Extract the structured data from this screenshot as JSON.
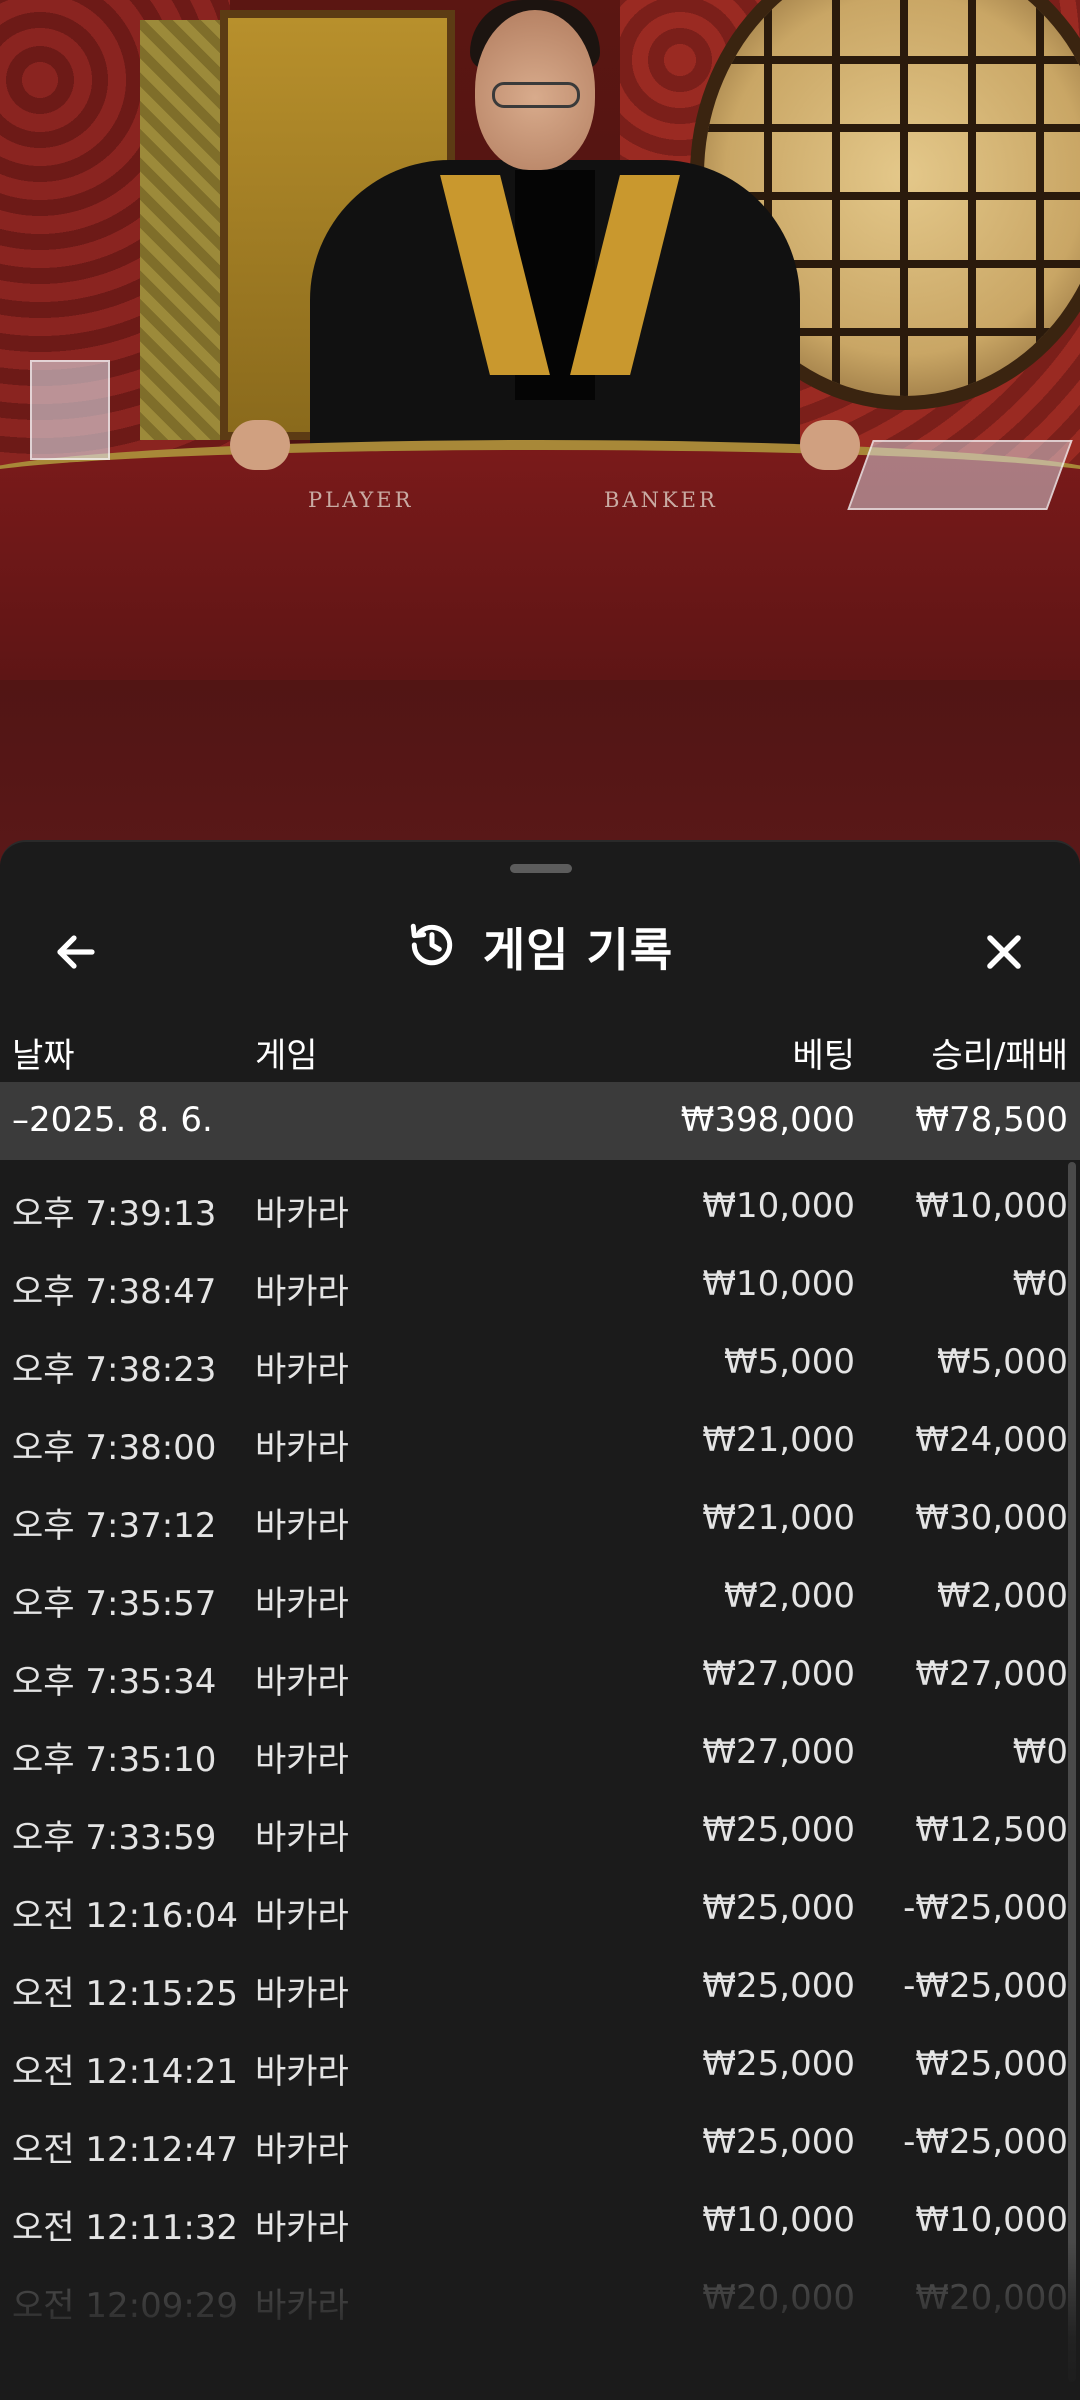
{
  "video": {
    "table_labels": {
      "player": "PLAYER",
      "banker": "BANKER"
    }
  },
  "sheet": {
    "title": "게임 기록",
    "icons": {
      "back": "arrow-left-icon",
      "history": "history-icon",
      "close": "close-icon"
    },
    "columns": {
      "date": "날짜",
      "game": "게임",
      "bet": "베팅",
      "winloss": "승리/패배"
    },
    "summary": {
      "date": "–2025. 8. 6.",
      "bet": "₩398,000",
      "winloss": "₩78,500"
    },
    "rows": [
      {
        "time": "오후 7:39:13",
        "game": "바카라",
        "bet": "₩10,000",
        "winloss": "₩10,000"
      },
      {
        "time": "오후 7:38:47",
        "game": "바카라",
        "bet": "₩10,000",
        "winloss": "₩0"
      },
      {
        "time": "오후 7:38:23",
        "game": "바카라",
        "bet": "₩5,000",
        "winloss": "₩5,000"
      },
      {
        "time": "오후 7:38:00",
        "game": "바카라",
        "bet": "₩21,000",
        "winloss": "₩24,000"
      },
      {
        "time": "오후 7:37:12",
        "game": "바카라",
        "bet": "₩21,000",
        "winloss": "₩30,000"
      },
      {
        "time": "오후 7:35:57",
        "game": "바카라",
        "bet": "₩2,000",
        "winloss": "₩2,000"
      },
      {
        "time": "오후 7:35:34",
        "game": "바카라",
        "bet": "₩27,000",
        "winloss": "₩27,000"
      },
      {
        "time": "오후 7:35:10",
        "game": "바카라",
        "bet": "₩27,000",
        "winloss": "₩0"
      },
      {
        "time": "오후 7:33:59",
        "game": "바카라",
        "bet": "₩25,000",
        "winloss": "₩12,500"
      },
      {
        "time": "오전 12:16:04",
        "game": "바카라",
        "bet": "₩25,000",
        "winloss": "-₩25,000"
      },
      {
        "time": "오전 12:15:25",
        "game": "바카라",
        "bet": "₩25,000",
        "winloss": "-₩25,000"
      },
      {
        "time": "오전 12:14:21",
        "game": "바카라",
        "bet": "₩25,000",
        "winloss": "₩25,000"
      },
      {
        "time": "오전 12:12:47",
        "game": "바카라",
        "bet": "₩25,000",
        "winloss": "-₩25,000"
      },
      {
        "time": "오전 12:11:32",
        "game": "바카라",
        "bet": "₩10,000",
        "winloss": "₩10,000"
      },
      {
        "time": "오전 12:09:29",
        "game": "바카라",
        "bet": "₩20,000",
        "winloss": "₩20,000"
      }
    ]
  }
}
